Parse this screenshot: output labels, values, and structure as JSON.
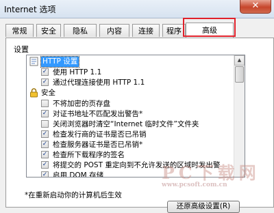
{
  "window": {
    "title": "Internet 选项",
    "close_glyph": "✕"
  },
  "tabs": [
    {
      "label": "常规"
    },
    {
      "label": "安全"
    },
    {
      "label": "隐私"
    },
    {
      "label": "内容"
    },
    {
      "label": "连接"
    },
    {
      "label": "程序"
    },
    {
      "label": "高级",
      "active": true
    }
  ],
  "panel": {
    "section_label": "设置",
    "list": [
      {
        "type": "category",
        "label": "HTTP 设置",
        "icon": "settings-icon",
        "selected": true
      },
      {
        "type": "option",
        "label": "使用 HTTP 1.1",
        "checked": true
      },
      {
        "type": "option",
        "label": "通过代理连接使用 HTTP 1.1",
        "checked": true
      },
      {
        "type": "category",
        "label": "安全",
        "icon": "lock-icon"
      },
      {
        "type": "option",
        "label": "不将加密的页存盘",
        "checked": false
      },
      {
        "type": "option",
        "label": "对证书地址不匹配发出警告*",
        "checked": true
      },
      {
        "type": "option",
        "label": "关闭浏览器时清空“Internet 临时文件”文件夹",
        "checked": false
      },
      {
        "type": "option",
        "label": "检查发行商的证书是否已吊销",
        "checked": true
      },
      {
        "type": "option",
        "label": "检查服务器证书是否已吊销*",
        "checked": true
      },
      {
        "type": "option",
        "label": "检查所下载程序的签名",
        "checked": true
      },
      {
        "type": "option",
        "label": "将提交的 POST 重定向到不允许发送的区域时发出警",
        "checked": true
      },
      {
        "type": "option",
        "label": "启用 DOM 存储",
        "checked": true
      }
    ],
    "footnote": "*在重新启动你的计算机后生效",
    "restore_button": "还原高级设置(R)"
  },
  "watermark": {
    "text": "PC下载网",
    "url": "www.pcsoft.com.cn"
  },
  "colors": {
    "highlight": "#e0202a",
    "selection": "#3399ff"
  }
}
